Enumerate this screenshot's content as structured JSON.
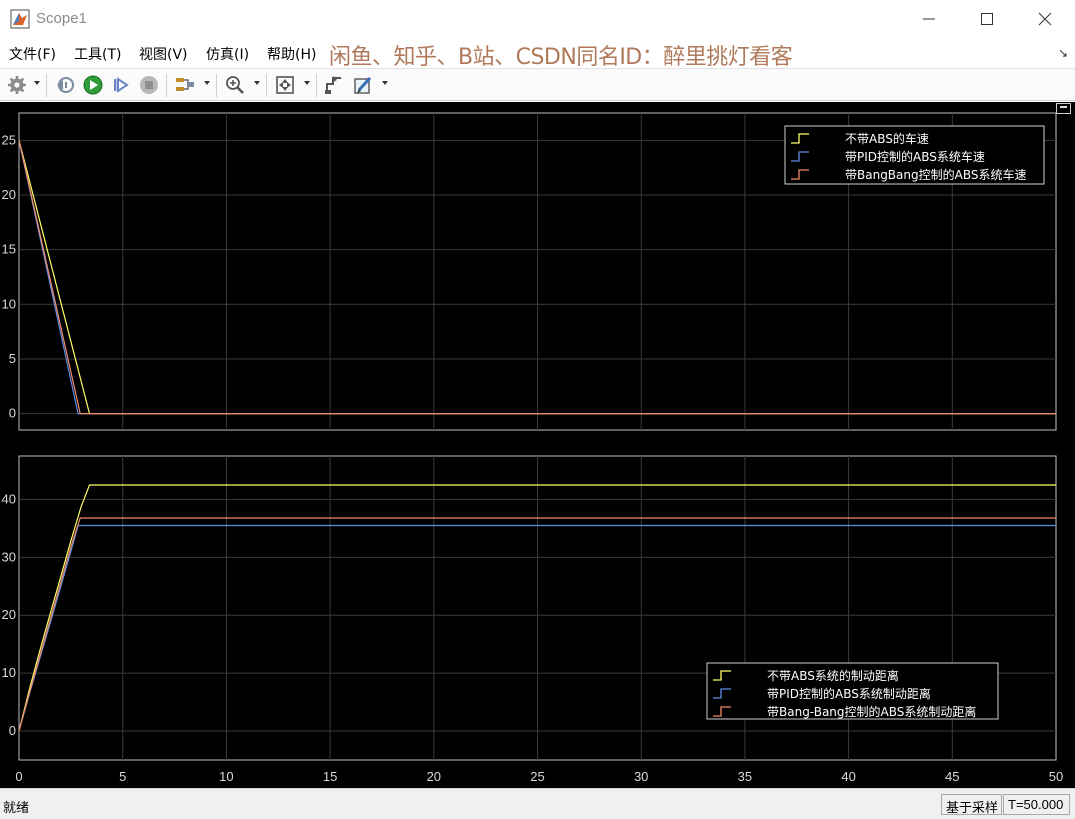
{
  "window": {
    "title": "Scope1"
  },
  "menu": {
    "file": "文件(F)",
    "tools": "工具(T)",
    "view": "视图(V)",
    "simulation": "仿真(I)",
    "help": "帮助(H)",
    "watermark": "闲鱼、知乎、B站、CSDN同名ID：醉里挑灯看客"
  },
  "toolbar": {
    "icons": [
      "gear-icon",
      "step-back-icon",
      "run-icon",
      "step-forward-icon",
      "stop-icon",
      "signal-select-icon",
      "zoom-icon",
      "autoscale-icon",
      "cursor-measure-icon",
      "highlight-icon"
    ]
  },
  "colors": {
    "background": "#000000",
    "grid": "#3a3a3a",
    "axes_border": "#bfbfbf",
    "no_abs": "#ffff66",
    "pid_abs": "#5f8fe8",
    "bangbang_abs": "#f28a6a"
  },
  "chart_data": [
    {
      "type": "line",
      "title": "",
      "xlim": [
        0,
        50
      ],
      "ylim": [
        -1.5,
        27.5
      ],
      "xticks": [
        0,
        5,
        10,
        15,
        20,
        25,
        30,
        35,
        40,
        45,
        50
      ],
      "yticks": [
        0,
        5,
        10,
        15,
        20,
        25
      ],
      "show_xtick_labels": false,
      "grid": true,
      "legend_position": "top-right",
      "series": [
        {
          "name": "不带ABS的车速",
          "color": "#ffff66",
          "x": [
            0,
            3.4,
            50
          ],
          "y": [
            25,
            0,
            0
          ]
        },
        {
          "name": "带PID控制的ABS系统车速",
          "color": "#5f8fe8",
          "x": [
            0,
            2.85,
            50
          ],
          "y": [
            25,
            0,
            0
          ]
        },
        {
          "name": "带BangBang控制的ABS系统车速",
          "color": "#f28a6a",
          "x": [
            0,
            2.95,
            50
          ],
          "y": [
            25,
            0,
            0
          ]
        }
      ]
    },
    {
      "type": "line",
      "title": "",
      "xlim": [
        0,
        50
      ],
      "ylim": [
        -5,
        47.5
      ],
      "xticks": [
        0,
        5,
        10,
        15,
        20,
        25,
        30,
        35,
        40,
        45,
        50
      ],
      "yticks": [
        0,
        10,
        20,
        30,
        40
      ],
      "show_xtick_labels": true,
      "grid": true,
      "legend_position": "bottom-right",
      "series": [
        {
          "name": "不带ABS系统的制动距离",
          "color": "#ffff66",
          "x": [
            0,
            0.5,
            1,
            1.5,
            2,
            2.5,
            3,
            3.4,
            50
          ],
          "y": [
            0,
            7.2,
            13.8,
            20.2,
            26.5,
            32.8,
            38.8,
            42.5,
            42.5
          ]
        },
        {
          "name": "带PID控制的ABS系统制动距离",
          "color": "#5f8fe8",
          "x": [
            0,
            0.5,
            1,
            1.5,
            2,
            2.5,
            2.85,
            50
          ],
          "y": [
            0,
            6.4,
            12.5,
            18.6,
            24.8,
            31.0,
            35.5,
            35.5
          ]
        },
        {
          "name": "带Bang-Bang控制的ABS系统制动距离",
          "color": "#f28a6a",
          "x": [
            0,
            0.5,
            1,
            1.5,
            2,
            2.5,
            2.95,
            50
          ],
          "y": [
            0,
            6.6,
            12.9,
            19.2,
            25.5,
            31.8,
            36.8,
            36.8
          ]
        }
      ]
    }
  ],
  "status": {
    "text": "就绪",
    "sample_mode": "基于采样",
    "time": "T=50.000"
  }
}
